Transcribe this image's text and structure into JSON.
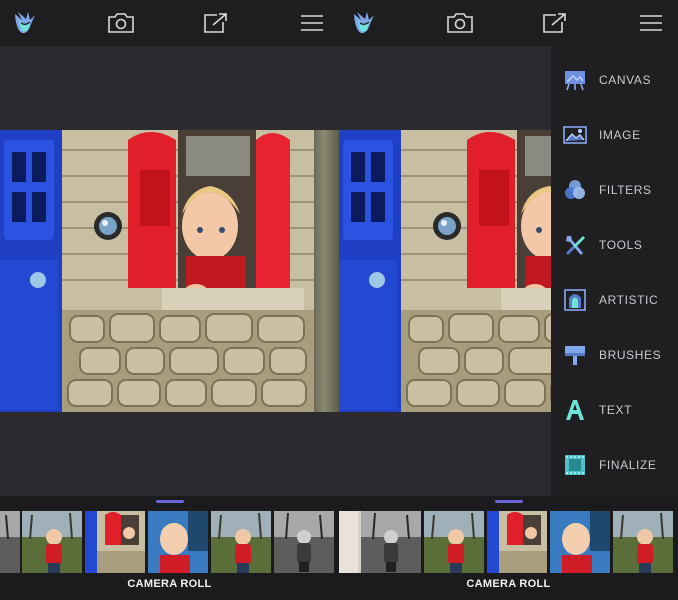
{
  "toolbar": {
    "logo_icon": "app-logo-icon",
    "camera_icon": "camera-icon",
    "share_icon": "share-icon",
    "menu_icon": "hamburger-menu-icon"
  },
  "bottom": {
    "camera_roll_label": "CAMERA ROLL"
  },
  "menu": {
    "items": [
      {
        "label": "CANVAS",
        "icon": "canvas-icon"
      },
      {
        "label": "IMAGE",
        "icon": "image-icon"
      },
      {
        "label": "FILTERS",
        "icon": "filters-icon"
      },
      {
        "label": "TOOLS",
        "icon": "tools-icon"
      },
      {
        "label": "ARTISTIC",
        "icon": "artistic-icon"
      },
      {
        "label": "BRUSHES",
        "icon": "brushes-icon"
      },
      {
        "label": "TEXT",
        "icon": "text-icon"
      },
      {
        "label": "FINALIZE",
        "icon": "finalize-icon"
      }
    ]
  },
  "colors": {
    "accent": "#6b64d8",
    "toolbar_bg": "#1e1e21",
    "panel_bg": "#1f1f22",
    "icon_blue": "#7fa8e8",
    "icon_teal": "#6fe3d8"
  }
}
